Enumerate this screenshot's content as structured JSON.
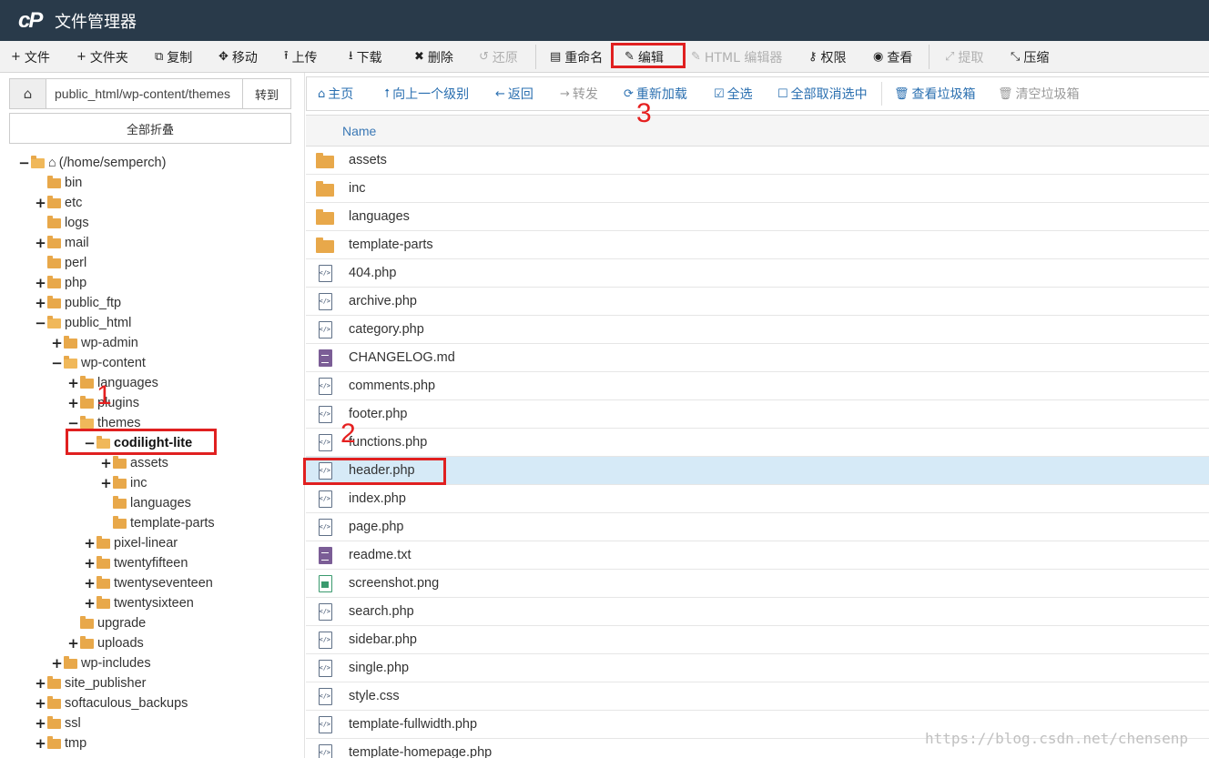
{
  "header": {
    "logo": "cP",
    "title": "文件管理器"
  },
  "toolbar": {
    "items": [
      {
        "icon": "+",
        "label": "文件"
      },
      {
        "icon": "+",
        "label": "文件夹"
      },
      {
        "icon": "⧉",
        "label": "复制"
      },
      {
        "icon": "✥",
        "label": "移动"
      },
      {
        "icon": "⭱",
        "label": "上传"
      },
      {
        "icon": "⭳",
        "label": "下载"
      },
      {
        "icon": "✖",
        "label": "删除"
      },
      {
        "icon": "↺",
        "label": "还原"
      },
      {
        "icon": "▤",
        "label": "重命名"
      },
      {
        "icon": "✎",
        "label": "编辑"
      },
      {
        "icon": "✎",
        "label": "HTML 编辑器"
      },
      {
        "icon": "⚷",
        "label": "权限"
      },
      {
        "icon": "◉",
        "label": "查看"
      },
      {
        "icon": "⤢",
        "label": "提取"
      },
      {
        "icon": "⤡",
        "label": "压缩"
      }
    ]
  },
  "sidebar": {
    "path_value": "public_html/wp-content/themes",
    "go_label": "转到",
    "collapse_all_label": "全部折叠",
    "tree": [
      {
        "toggle": "−",
        "label": "(/home/semperch)"
      },
      {
        "toggle": "",
        "label": "bin"
      },
      {
        "toggle": "+",
        "label": "etc"
      },
      {
        "toggle": "",
        "label": "logs"
      },
      {
        "toggle": "+",
        "label": "mail"
      },
      {
        "toggle": "",
        "label": "perl"
      },
      {
        "toggle": "+",
        "label": "php"
      },
      {
        "toggle": "+",
        "label": "public_ftp"
      },
      {
        "toggle": "−",
        "label": "public_html"
      },
      {
        "toggle": "+",
        "label": "wp-admin"
      },
      {
        "toggle": "−",
        "label": "wp-content"
      },
      {
        "toggle": "+",
        "label": "languages"
      },
      {
        "toggle": "+",
        "label": "plugins"
      },
      {
        "toggle": "−",
        "label": "themes"
      },
      {
        "toggle": "−",
        "label": "codilight-lite"
      },
      {
        "toggle": "+",
        "label": "assets"
      },
      {
        "toggle": "+",
        "label": "inc"
      },
      {
        "toggle": "",
        "label": "languages"
      },
      {
        "toggle": "",
        "label": "template-parts"
      },
      {
        "toggle": "+",
        "label": "pixel-linear"
      },
      {
        "toggle": "+",
        "label": "twentyfifteen"
      },
      {
        "toggle": "+",
        "label": "twentyseventeen"
      },
      {
        "toggle": "+",
        "label": "twentysixteen"
      },
      {
        "toggle": "",
        "label": "upgrade"
      },
      {
        "toggle": "+",
        "label": "uploads"
      },
      {
        "toggle": "+",
        "label": "wp-includes"
      },
      {
        "toggle": "+",
        "label": "site_publisher"
      },
      {
        "toggle": "+",
        "label": "softaculous_backups"
      },
      {
        "toggle": "+",
        "label": "ssl"
      },
      {
        "toggle": "+",
        "label": "tmp"
      }
    ]
  },
  "nav": {
    "items": [
      {
        "icon": "⌂",
        "label": "主页"
      },
      {
        "icon": "⭡",
        "label": "向上一个级别"
      },
      {
        "icon": "←",
        "label": "返回"
      },
      {
        "icon": "→",
        "label": "转发"
      },
      {
        "icon": "⟳",
        "label": "重新加载"
      },
      {
        "icon": "☑",
        "label": "全选"
      },
      {
        "icon": "☐",
        "label": "全部取消选中"
      },
      {
        "icon": "🗑",
        "label": "查看垃圾箱"
      },
      {
        "icon": "🗑",
        "label": "清空垃圾箱"
      }
    ]
  },
  "files": {
    "column_name": "Name",
    "rows": [
      {
        "name": "assets",
        "type": "folder"
      },
      {
        "name": "inc",
        "type": "folder"
      },
      {
        "name": "languages",
        "type": "folder"
      },
      {
        "name": "template-parts",
        "type": "folder"
      },
      {
        "name": "404.php",
        "type": "code"
      },
      {
        "name": "archive.php",
        "type": "code"
      },
      {
        "name": "category.php",
        "type": "code"
      },
      {
        "name": "CHANGELOG.md",
        "type": "text"
      },
      {
        "name": "comments.php",
        "type": "code"
      },
      {
        "name": "footer.php",
        "type": "code"
      },
      {
        "name": "functions.php",
        "type": "code"
      },
      {
        "name": "header.php",
        "type": "code"
      },
      {
        "name": "index.php",
        "type": "code"
      },
      {
        "name": "page.php",
        "type": "code"
      },
      {
        "name": "readme.txt",
        "type": "text"
      },
      {
        "name": "screenshot.png",
        "type": "image"
      },
      {
        "name": "search.php",
        "type": "code"
      },
      {
        "name": "sidebar.php",
        "type": "code"
      },
      {
        "name": "single.php",
        "type": "code"
      },
      {
        "name": "style.css",
        "type": "code"
      },
      {
        "name": "template-fullwidth.php",
        "type": "code"
      },
      {
        "name": "template-homepage.php",
        "type": "code"
      }
    ]
  },
  "annotations": {
    "one": "1",
    "two": "2",
    "three": "3"
  },
  "watermark": "https://blog.csdn.net/chensenp",
  "colors": {
    "header_bg": "#293a4a",
    "link": "#2a6fb0",
    "folder": "#e8a84a",
    "highlight_box": "#e02020",
    "selected_row": "#d6eaf7"
  }
}
